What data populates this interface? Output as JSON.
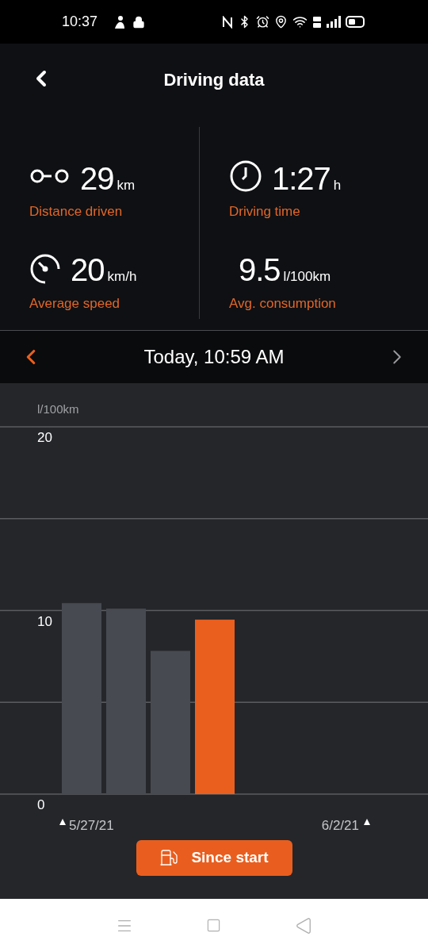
{
  "status_bar": {
    "time": "10:37"
  },
  "header": {
    "title": "Driving data"
  },
  "stats": [
    {
      "kind": "distance",
      "value": "29",
      "unit": "km",
      "label": "Distance driven"
    },
    {
      "kind": "time",
      "value": "1:27",
      "unit": "h",
      "label": "Driving time"
    },
    {
      "kind": "speed",
      "value": "20",
      "unit": "km/h",
      "label": "Average speed"
    },
    {
      "kind": "consumption",
      "value": "9.5",
      "unit": "l/100km",
      "label": "Avg. consumption"
    }
  ],
  "period": {
    "label": "Today, 10:59 AM",
    "previous_enabled": true,
    "next_enabled": false
  },
  "chart": {
    "chart_data": {
      "type": "bar",
      "ylabel": "l/100km",
      "categories": [
        "5/27/21",
        null,
        null,
        null,
        null,
        null,
        "6/2/21"
      ],
      "ylim": [
        0,
        20
      ],
      "yticks": [
        0,
        10,
        20
      ],
      "values": [
        10.4,
        10.1,
        7.8,
        9.5,
        null,
        null,
        null
      ]
    },
    "bars": [
      {
        "selected": false
      },
      {
        "selected": false
      },
      {
        "selected": false
      },
      {
        "selected": true
      }
    ]
  },
  "button": {
    "label": "Since start"
  }
}
